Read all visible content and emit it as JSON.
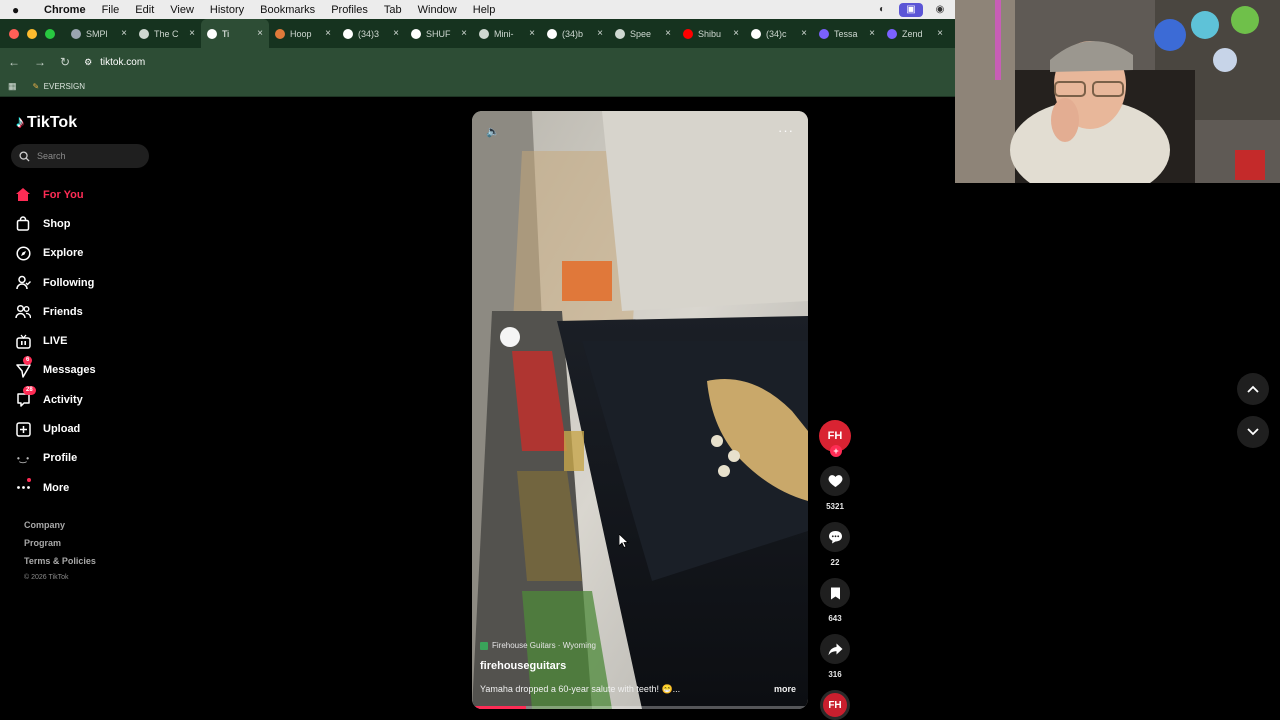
{
  "menubar": {
    "app": "Chrome",
    "items": [
      "File",
      "Edit",
      "View",
      "History",
      "Bookmarks",
      "Profiles",
      "Tab",
      "Window",
      "Help"
    ]
  },
  "tabs": [
    {
      "title": "SMPl",
      "color": "#9aa5b0"
    },
    {
      "title": "The C",
      "color": "#cfd8d1"
    },
    {
      "title": "Ti",
      "color": "#ffffff",
      "active": true
    },
    {
      "title": "Hoop",
      "color": "#e07a3a"
    },
    {
      "title": "(34)3",
      "color": "#ffffff"
    },
    {
      "title": "SHUF",
      "color": "#ffffff"
    },
    {
      "title": "Mini-",
      "color": "#cfd8d1"
    },
    {
      "title": "(34)b",
      "color": "#ffffff"
    },
    {
      "title": "Spee",
      "color": "#cfd8d1"
    },
    {
      "title": "Shibu",
      "color": "#ff0000"
    },
    {
      "title": "(34)c",
      "color": "#ffffff"
    },
    {
      "title": "Tessa",
      "color": "#7b61ff"
    },
    {
      "title": "Zend",
      "color": "#7b61ff"
    }
  ],
  "address": {
    "url": "tiktok.com"
  },
  "bookmarks": {
    "item": "EVERSIGN"
  },
  "tiktok": {
    "brand": "TikTok",
    "search_placeholder": "Search",
    "nav": {
      "for_you": "For You",
      "shop": "Shop",
      "explore": "Explore",
      "following": "Following",
      "friends": "Friends",
      "live": "LIVE",
      "messages": "Messages",
      "messages_badge": "6",
      "activity": "Activity",
      "activity_badge": "28",
      "upload": "Upload",
      "profile": "Profile",
      "more": "More"
    },
    "footer": {
      "company": "Company",
      "program": "Program",
      "terms": "Terms & Policies",
      "copyright": "© 2026 TikTok"
    }
  },
  "video": {
    "location": "Firehouse Guitars · Wyoming",
    "author": "firehouseguitars",
    "caption": "Yamaha dropped a 60-year salute with teeth! 😁...",
    "more": "more",
    "progress": 0.16
  },
  "actions": {
    "avatar_initials": "FH",
    "likes": "5321",
    "comments": "22",
    "saves": "643",
    "shares": "316"
  },
  "colors": {
    "accent": "#fe2c55",
    "chrome_dark": "#16331f",
    "chrome_toolbar": "#2d4d35"
  }
}
